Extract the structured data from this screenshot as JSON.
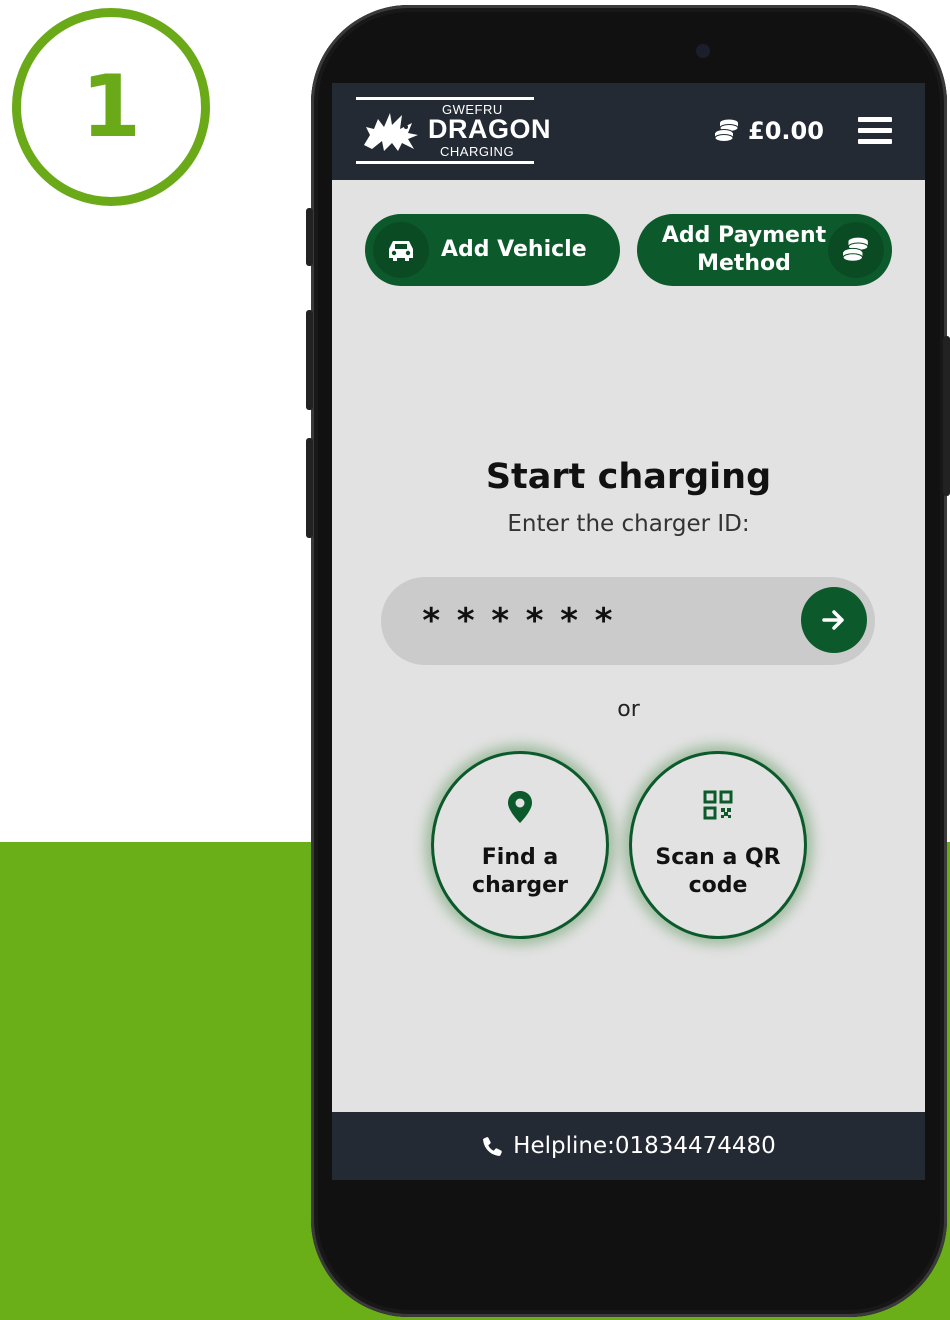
{
  "step": {
    "number": "1"
  },
  "header": {
    "logo": {
      "top": "GWEFRU",
      "main": "DRAGON",
      "bottom": "CHARGING"
    },
    "balance": "£0.00",
    "menu_icon": "hamburger-menu-icon"
  },
  "actions": {
    "add_vehicle": {
      "label": "Add Vehicle",
      "icon": "car-icon"
    },
    "add_payment": {
      "label": "Add Payment Method",
      "icon": "coins-icon"
    }
  },
  "main": {
    "title": "Start charging",
    "subtitle": "Enter the charger ID:",
    "charger_id": {
      "value": "",
      "placeholder": "******",
      "submit_icon": "arrow-right-icon"
    },
    "or": "or",
    "find_charger": {
      "label": "Find a charger",
      "icon": "map-marker-icon"
    },
    "scan_qr": {
      "label": "Scan a QR code",
      "icon": "qr-code-icon"
    }
  },
  "footer": {
    "helpline": "Helpline:01834474480",
    "icon": "phone-icon"
  },
  "colors": {
    "brand_green": "#0c5a2b",
    "accent_green": "#6aaa18",
    "header_bg": "#242a33",
    "screen_bg": "#e2e2e2"
  }
}
